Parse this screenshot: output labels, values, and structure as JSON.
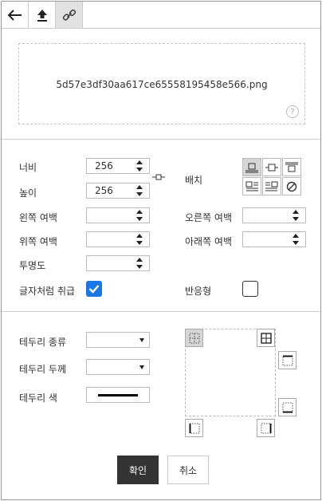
{
  "tabs": [
    {
      "id": "back",
      "icon": "arrow-left-icon",
      "active": false
    },
    {
      "id": "upload",
      "icon": "upload-icon",
      "active": false
    },
    {
      "id": "link",
      "icon": "link-icon",
      "active": true
    }
  ],
  "file": {
    "name": "5d57e3df30aa617ce65558195458e566.png",
    "help": "?"
  },
  "size": {
    "width_label": "너비",
    "width_value": "256",
    "height_label": "높이",
    "height_value": "256",
    "align_label": "배치"
  },
  "margins": {
    "left_label": "왼쪽 여백",
    "right_label": "오른쪽 여백",
    "top_label": "위쪽 여백",
    "bottom_label": "아래쪽 여백",
    "opacity_label": "투명도"
  },
  "flags": {
    "inline_label": "글자처럼 취급",
    "inline_checked": true,
    "responsive_label": "반응형",
    "responsive_checked": false
  },
  "border": {
    "type_label": "테두리 종류",
    "width_label": "테두리 두께",
    "color_label": "테두리 색"
  },
  "actions": {
    "ok_label": "확인",
    "cancel_label": "취소"
  },
  "colors": {
    "accent": "#1a78e6",
    "primary_button": "#333333",
    "active_tab": "#e2e2e2"
  }
}
